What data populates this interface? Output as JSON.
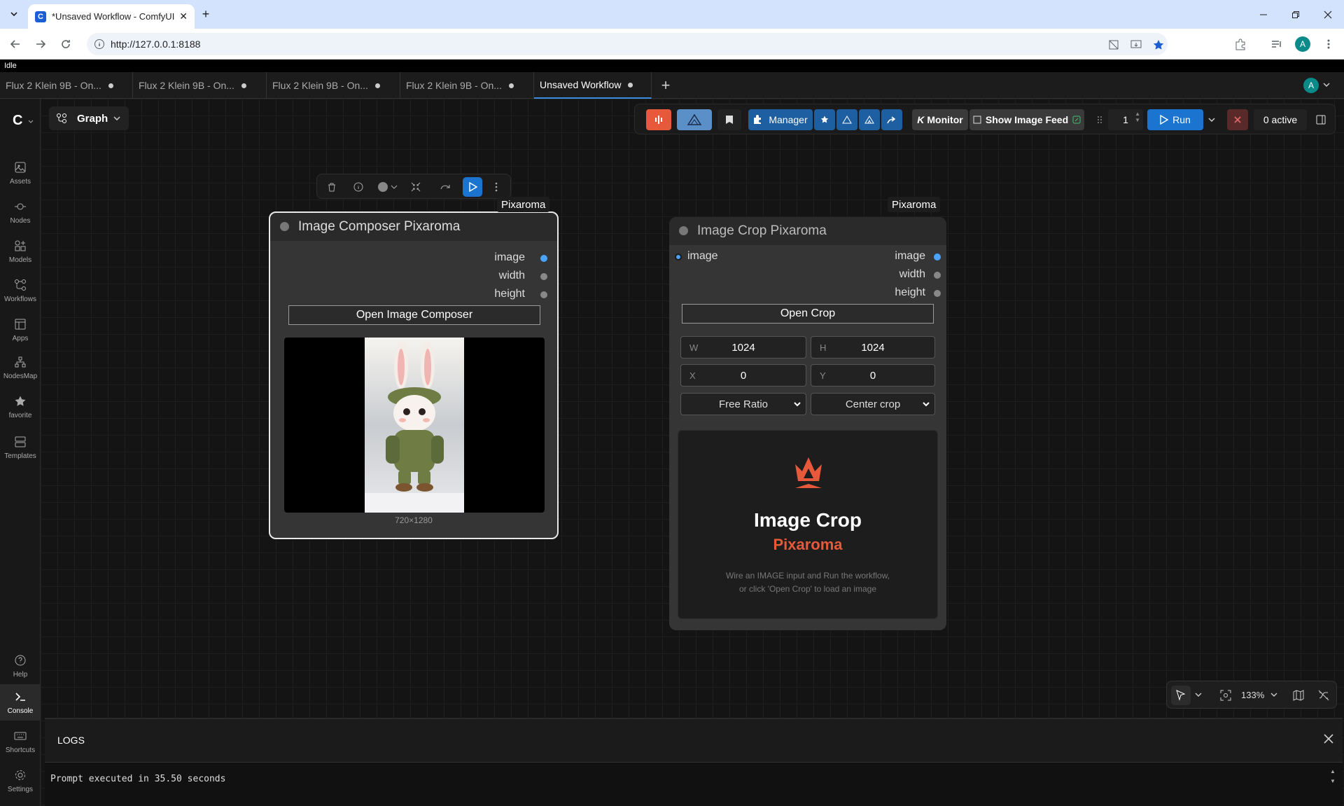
{
  "browser": {
    "tab_title": "*Unsaved Workflow - ComfyUI",
    "url": "http://127.0.0.1:8188",
    "avatar_letter": "A"
  },
  "app": {
    "status": "Idle",
    "workflow_tabs": [
      {
        "label": "Flux 2 Klein 9B - On..."
      },
      {
        "label": "Flux 2 Klein 9B - On..."
      },
      {
        "label": "Flux 2 Klein 9B - On..."
      },
      {
        "label": "Flux 2 Klein 9B - On..."
      },
      {
        "label": "Unsaved Workflow"
      }
    ],
    "user_avatar": "A",
    "graph_label": "Graph",
    "sidebar": {
      "items": [
        {
          "label": "Assets",
          "icon": "image-icon"
        },
        {
          "label": "Nodes",
          "icon": "nodes-icon"
        },
        {
          "label": "Models",
          "icon": "models-icon"
        },
        {
          "label": "Workflows",
          "icon": "workflows-icon"
        },
        {
          "label": "Apps",
          "icon": "apps-icon"
        },
        {
          "label": "NodesMap",
          "icon": "nodesmap-icon"
        },
        {
          "label": "favorite",
          "icon": "star-icon"
        },
        {
          "label": "Templates",
          "icon": "templates-icon"
        }
      ],
      "bottom": [
        {
          "label": "Help"
        },
        {
          "label": "Console"
        },
        {
          "label": "Shortcuts"
        },
        {
          "label": "Settings"
        }
      ]
    },
    "toolbar": {
      "manager": "Manager",
      "monitor_prefix": "K",
      "monitor": "Monitor",
      "image_feed": "Show Image Feed",
      "queue_count": "1",
      "run": "Run",
      "active": "0 active"
    },
    "zoom": "133%"
  },
  "nodes": {
    "composer": {
      "badge": "Pixaroma",
      "title": "Image Composer Pixaroma",
      "outputs": [
        "image",
        "width",
        "height"
      ],
      "button": "Open Image Composer",
      "image_size": "720×1280"
    },
    "crop": {
      "badge": "Pixaroma",
      "title": "Image Crop Pixaroma",
      "input": "image",
      "outputs": [
        "image",
        "width",
        "height"
      ],
      "button": "Open Crop",
      "w_label": "W",
      "w_value": "1024",
      "h_label": "H",
      "h_value": "1024",
      "x_label": "X",
      "x_value": "0",
      "y_label": "Y",
      "y_value": "0",
      "ratio": "Free Ratio",
      "mode": "Center crop",
      "placeholder_title": "Image Crop",
      "placeholder_sub": "Pixaroma",
      "placeholder_hint1": "Wire an IMAGE input and Run the workflow,",
      "placeholder_hint2": "or click 'Open Crop' to load an image"
    }
  },
  "logs": {
    "title": "LOGS",
    "line": "Prompt executed in 35.50 seconds"
  },
  "colors": {
    "accent_blue": "#1b75d0",
    "pixaroma_orange": "#e8583a",
    "manager_blue": "#1d5fa0"
  }
}
